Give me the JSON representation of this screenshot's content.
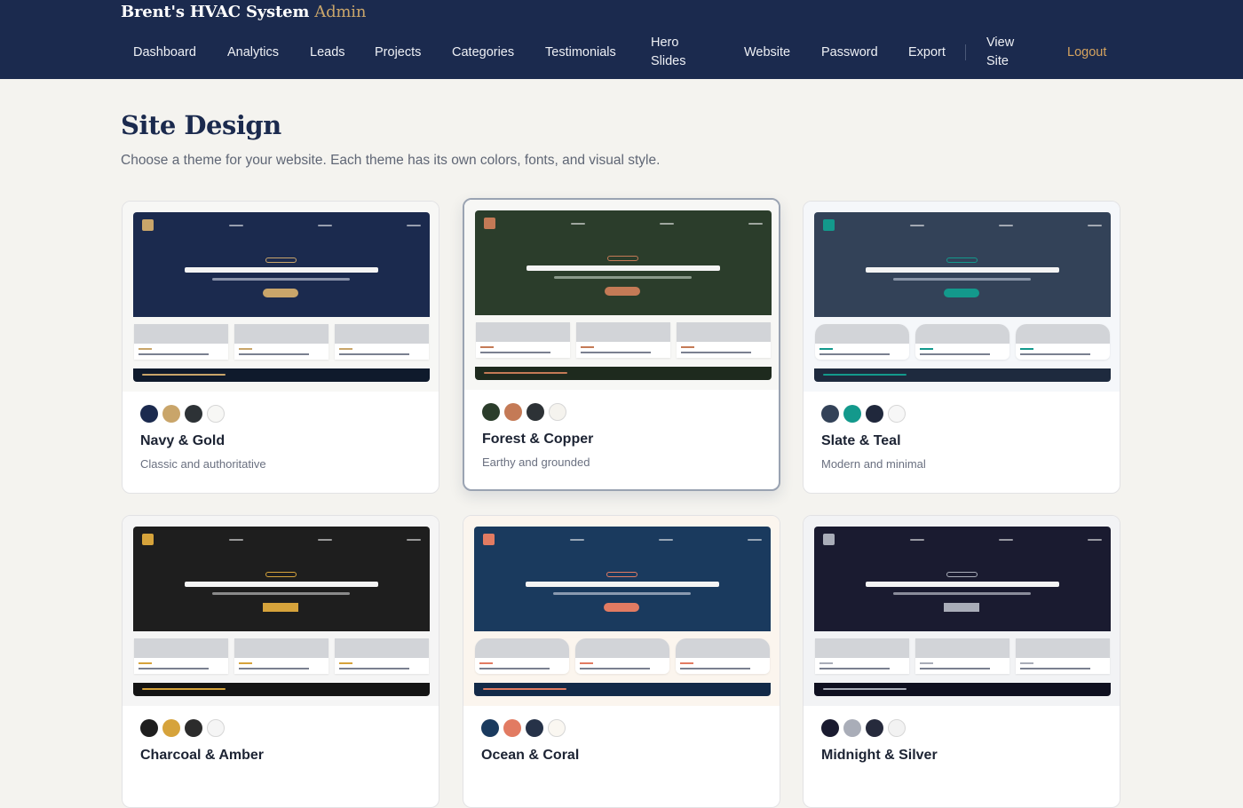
{
  "header": {
    "brand": "Brent's HVAC System",
    "brand_accent": "Admin",
    "nav": [
      {
        "label": "Dashboard"
      },
      {
        "label": "Analytics"
      },
      {
        "label": "Leads"
      },
      {
        "label": "Projects"
      },
      {
        "label": "Categories"
      },
      {
        "label": "Testimonials"
      },
      {
        "label": "Hero Slides"
      },
      {
        "label": "Website"
      },
      {
        "label": "Password"
      },
      {
        "label": "Export"
      },
      {
        "label": "View Site"
      },
      {
        "label": "Logout"
      }
    ]
  },
  "page": {
    "title": "Site Design",
    "subtitle": "Choose a theme for your website. Each theme has its own colors, fonts, and visual style."
  },
  "themes": [
    {
      "name": "Navy & Gold",
      "description": "Classic and authoritative",
      "selected": false,
      "colors": {
        "hero": "#1b2a4e",
        "accent": "#c9a56a",
        "foot": "#0f1a2c",
        "cards_bg": "#f7f7f5",
        "subline": "#8a93aa",
        "logo": "#c9a56a"
      },
      "swatches": [
        "#1b2a4e",
        "#c9a56a",
        "#2d3236",
        "#f7f7f5"
      ]
    },
    {
      "name": "Forest & Copper",
      "description": "Earthy and grounded",
      "selected": true,
      "colors": {
        "hero": "#2b3d2b",
        "accent": "#c47a56",
        "foot": "#1e2a1e",
        "cards_bg": "#f7f7f5",
        "subline": "#8b9a8b",
        "logo": "#c47a56"
      },
      "swatches": [
        "#2b3d2b",
        "#c47a56",
        "#2d3236",
        "#f5f3ee"
      ]
    },
    {
      "name": "Slate & Teal",
      "description": "Modern and minimal",
      "selected": false,
      "colors": {
        "hero": "#334258",
        "accent": "#13998c",
        "foot": "#1e2a3e",
        "cards_bg": "#f5f7fa",
        "subline": "#8a96a8",
        "logo": "#13998c"
      },
      "swatches": [
        "#334258",
        "#13998c",
        "#20283c",
        "#f7f7f7"
      ]
    },
    {
      "name": "Charcoal & Amber",
      "description": "",
      "selected": false,
      "colors": {
        "hero": "#1e1e1e",
        "accent": "#d6a33b",
        "foot": "#141414",
        "cards_bg": "#f5f5f5",
        "subline": "#8a8a8a",
        "logo": "#d6a33b"
      },
      "swatches": [
        "#1e1e1e",
        "#d6a33b",
        "#2c2c2c",
        "#f5f5f5"
      ]
    },
    {
      "name": "Ocean & Coral",
      "description": "",
      "selected": false,
      "colors": {
        "hero": "#1a3a5e",
        "accent": "#e27b62",
        "foot": "#132a48",
        "cards_bg": "#fbf5ee",
        "subline": "#8a9ab0",
        "logo": "#e27b62"
      },
      "swatches": [
        "#1a3a5e",
        "#e27b62",
        "#263248",
        "#faf7f1"
      ]
    },
    {
      "name": "Midnight & Silver",
      "description": "",
      "selected": false,
      "colors": {
        "hero": "#1a1b30",
        "accent": "#a9adb8",
        "foot": "#0f1020",
        "cards_bg": "#f2f3f5",
        "subline": "#8a8c9a",
        "logo": "#a9adb8"
      },
      "swatches": [
        "#1a1b30",
        "#a9adb8",
        "#262a3c",
        "#f2f2f2"
      ]
    }
  ]
}
